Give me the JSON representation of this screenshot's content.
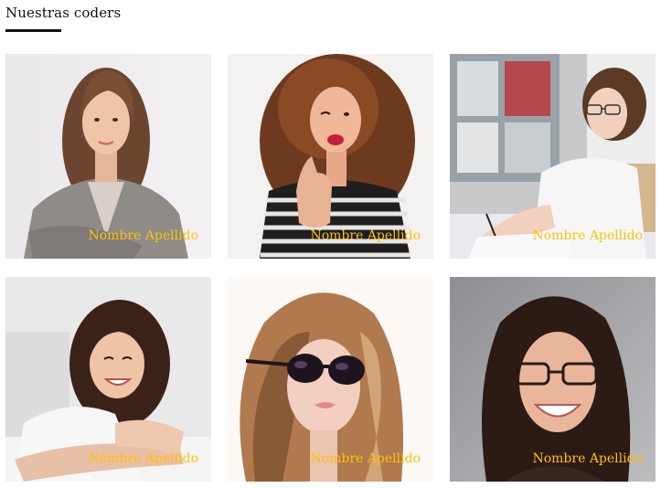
{
  "section": {
    "title": "Nuestras coders"
  },
  "coders": [
    {
      "name": "Nombre Apellido",
      "photo": "woman-blazer-portrait-photo"
    },
    {
      "name": "Nombre Apellido",
      "photo": "woman-thumbs-up-wink-photo"
    },
    {
      "name": "Nombre Apellido",
      "photo": "woman-writing-office-photo"
    },
    {
      "name": "Nombre Apellido",
      "photo": "woman-smiling-couch-photo"
    },
    {
      "name": "Nombre Apellido",
      "photo": "woman-sunglasses-photo"
    },
    {
      "name": "Nombre Apellido",
      "photo": "woman-glasses-smiling-photo"
    }
  ],
  "colors": {
    "name_label": "#ffc107",
    "heading": "#111111"
  }
}
